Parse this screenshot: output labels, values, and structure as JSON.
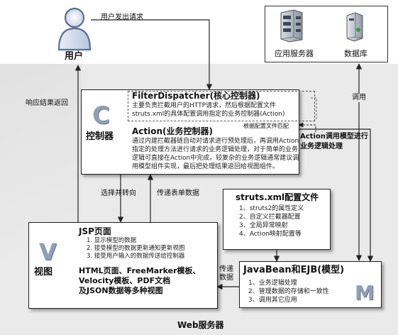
{
  "labels": {
    "user": "用户",
    "user_request": "用户发出请求",
    "response_return": "响应结果返回",
    "app_server": "应用服务器",
    "database": "数据库",
    "invoke": "调用",
    "action_invoke_model": "Action调用模型进行业务逻辑处理",
    "select_forward": "选择并转向",
    "pass_form": "传递表单数据",
    "pass_data": "传递数据",
    "config_match": "根据配置文件匹配",
    "web_server": "Web服务器"
  },
  "controller": {
    "letter": "C",
    "name": "控制器",
    "filter_title": "FilterDispatcher(核心控制器)",
    "filter_desc": [
      "主要负责拦截用户的HTTP请求，然后根据配置文件",
      "struts.xml的具体配置调用指定的业务控制器(Action)"
    ],
    "action_title": "Action(业务控制器)",
    "action_desc": [
      "通过内建拦截器链自动对请求进行预处理后，再调用Action",
      "指定的处理方法进行请求的业务逻辑处理，对于简单的业务",
      "逻辑可直接在Action中完成，较复杂的业务逻辑通常建议调",
      "用模型组件实现，最后把处理结果返回给视图组件。"
    ]
  },
  "config": {
    "title": "struts.xml配置文件",
    "items": [
      "1、struts2的属性定义",
      "2、自定义拦截器配置",
      "3、全局异常映射",
      "4、Action映射配置等"
    ]
  },
  "view": {
    "letter": "V",
    "name": "视图",
    "jsp_title": "JSP页面",
    "jsp_items": [
      "1. 显示模型的数据",
      "2. 接受模型的数据更新通知更新视图",
      "3. 接受用户输入的数据传送给控制器"
    ],
    "other_views": [
      "HTML页面、FreeMarker模板、",
      "Velocity模板、PDF文档",
      "及JSON数据等多种视图"
    ]
  },
  "model": {
    "letter": "M",
    "title": "JavaBean和EJB(模型)",
    "items": [
      "1、业务逻辑处理",
      "2、管理数据的存储和一致性",
      "3、调用其它应用"
    ]
  }
}
